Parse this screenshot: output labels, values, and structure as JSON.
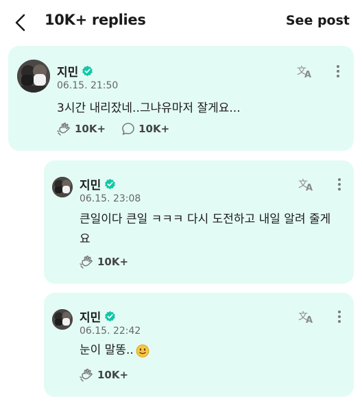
{
  "header": {
    "title": "10K+ replies",
    "see_post": "See post",
    "back_icon": "chevron-left-icon"
  },
  "main_post": {
    "author": "지민",
    "verified": true,
    "time": "06.15. 21:50",
    "text": "3시간 내리잤네..그냐유마저 잘게요...",
    "likes": "10K+",
    "comments": "10K+"
  },
  "replies": [
    {
      "author": "지민",
      "verified": true,
      "time": "06.15. 23:08",
      "text": "큰일이다 큰일 ㅋㅋㅋ 다시 도전하고 내일 알려 줄게요",
      "likes": "10K+"
    },
    {
      "author": "지민",
      "verified": true,
      "time": "06.15. 22:42",
      "text": "눈이 말똥..",
      "likes": "10K+"
    }
  ],
  "colors": {
    "card_bg": "#e3fbf5",
    "verified": "#11c6a8",
    "icon": "#7a7a7a"
  }
}
